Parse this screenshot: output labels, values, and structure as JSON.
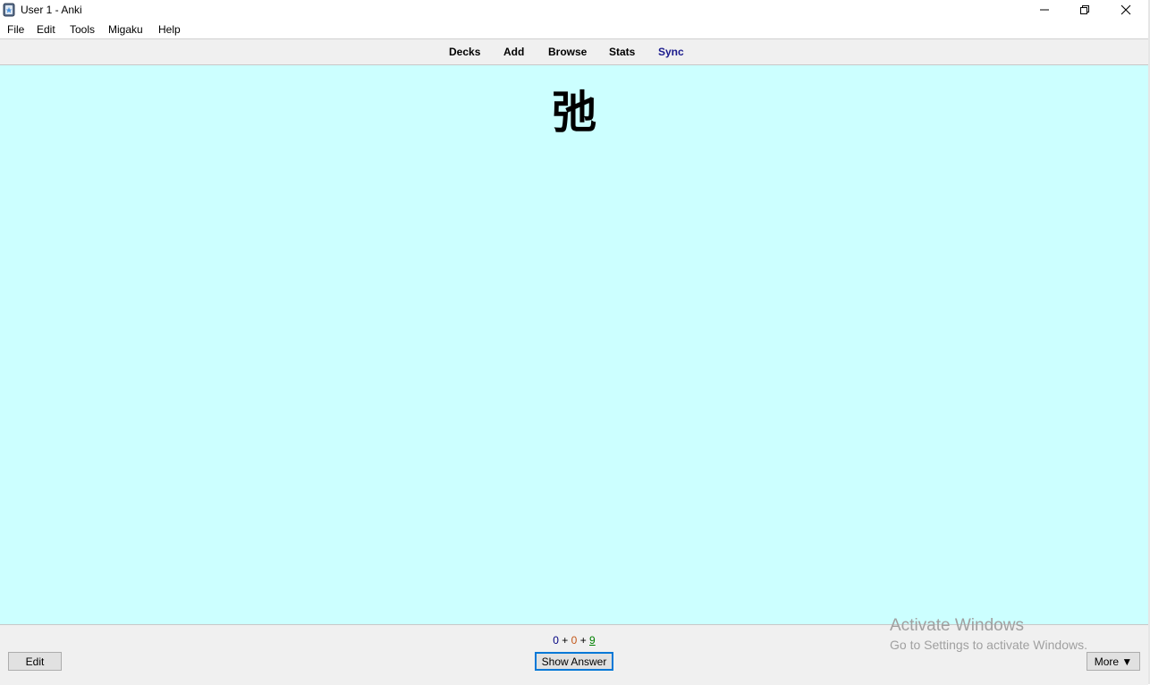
{
  "window": {
    "title": "User 1 - Anki",
    "minimize_icon": "minimize-icon",
    "restore_icon": "restore-icon",
    "close_icon": "close-icon"
  },
  "menu": [
    "File",
    "Edit",
    "Tools",
    "Migaku",
    "Help"
  ],
  "toolbar": {
    "decks": "Decks",
    "add": "Add",
    "browse": "Browse",
    "stats": "Stats",
    "sync": "Sync"
  },
  "card": {
    "front": "弛",
    "background": "#ccffff"
  },
  "counts": {
    "new": "0",
    "learning": "0",
    "review": "9",
    "sep": "+"
  },
  "bottom": {
    "edit": "Edit",
    "show_answer": "Show Answer",
    "more": "More ▼"
  },
  "watermark": {
    "line1": "Activate Windows",
    "line2": "Go to Settings to activate Windows."
  }
}
